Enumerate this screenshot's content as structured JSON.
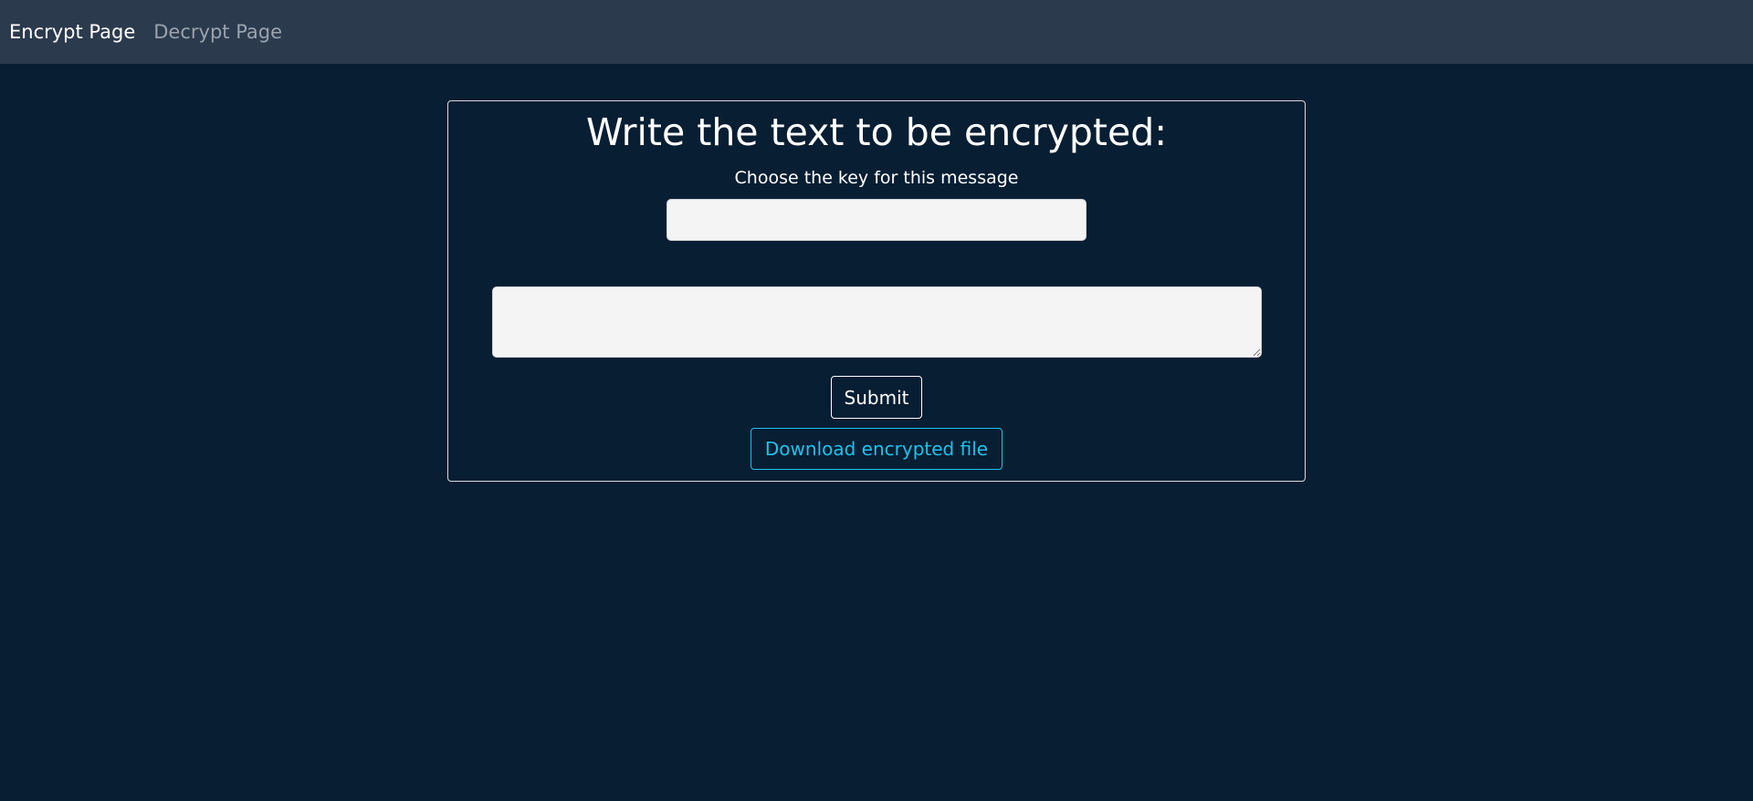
{
  "navbar": {
    "links": [
      {
        "label": "Encrypt Page",
        "active": true
      },
      {
        "label": "Decrypt Page",
        "active": false
      }
    ]
  },
  "form": {
    "title": "Write the text to be encrypted:",
    "key_label": "Choose the key for this message",
    "key_value": "",
    "key_placeholder": "",
    "message_value": "",
    "message_placeholder": "",
    "submit_label": "Submit",
    "download_label": "Download encrypted file"
  },
  "colors": {
    "page_background": "#081e33",
    "navbar_background": "#2c3a4e",
    "accent": "#1ec3ea",
    "input_background": "#f4f4f4"
  }
}
